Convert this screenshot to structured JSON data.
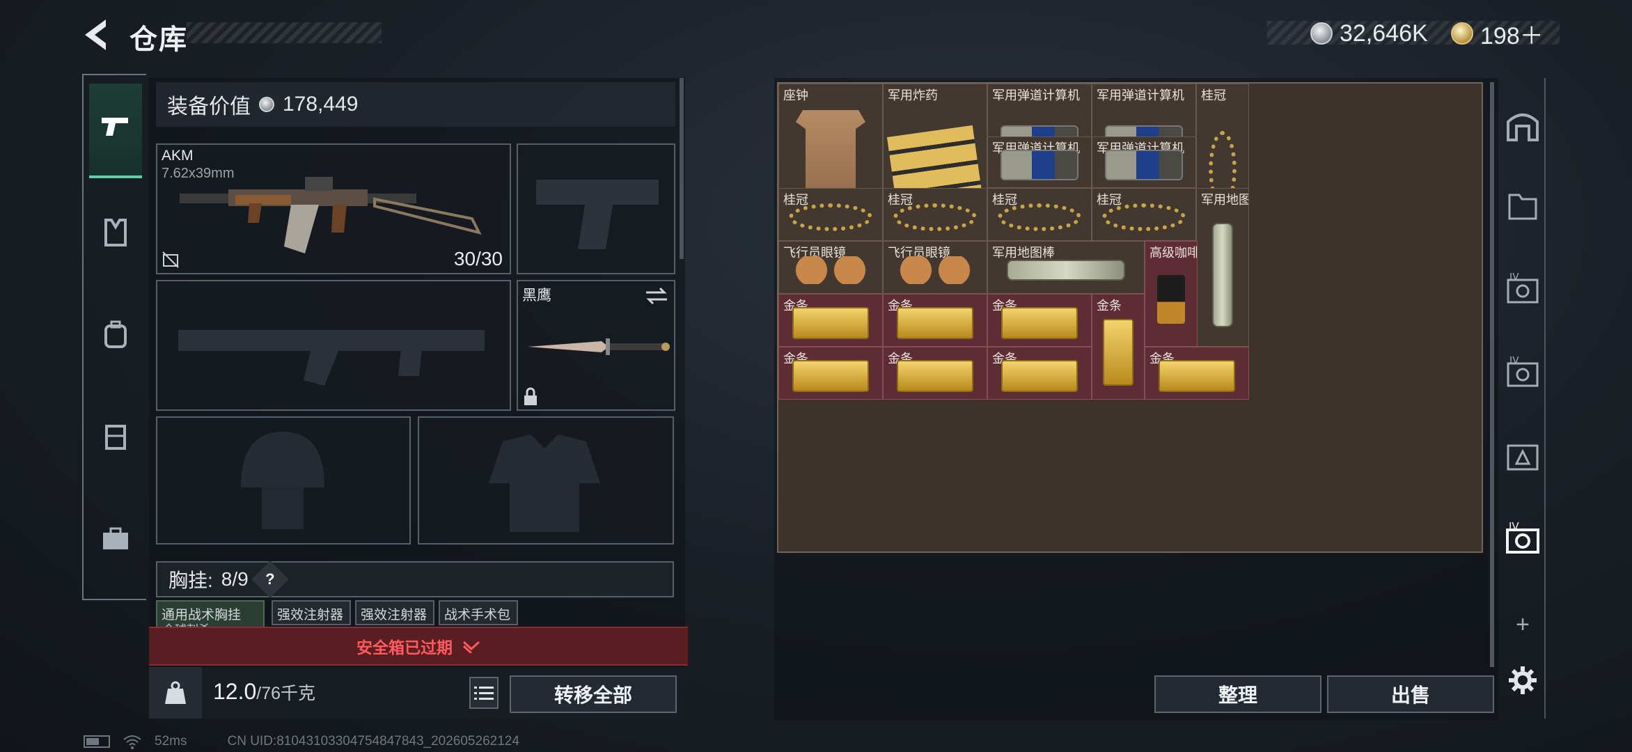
{
  "header": {
    "title": "仓库",
    "currencies": [
      {
        "icon": "silver-coin-icon",
        "value": "32,646K"
      },
      {
        "icon": "gold-coin-icon",
        "value": "198＋"
      }
    ]
  },
  "left_nav": {
    "items": [
      {
        "icon": "pistol-icon",
        "active": true
      },
      {
        "icon": "armor-vest-icon",
        "active": false
      },
      {
        "icon": "backpack-icon",
        "active": false
      },
      {
        "icon": "case-icon",
        "active": false
      },
      {
        "icon": "toolbox-icon",
        "active": false
      }
    ]
  },
  "equipment": {
    "value_label": "装备价值",
    "value": "178,449",
    "primary_weapon": {
      "name": "AKM",
      "caliber": "7.62x39mm",
      "ammo": "30/30"
    },
    "melee": {
      "name": "黑鹰"
    },
    "rig": {
      "label": "胸挂:",
      "capacity": "8/9",
      "help": "?"
    },
    "rig_items": [
      {
        "label": "通用战术胸挂",
        "sub": "全球刺杀"
      },
      {
        "label": "强效注射器"
      },
      {
        "label": "强效注射器"
      },
      {
        "label": "战术手术包"
      }
    ],
    "safe_box_status": "安全箱已过期",
    "weight": "12.0",
    "weight_cap": "/76千克",
    "transfer_all": "转移全部"
  },
  "status_bar": {
    "ping": "52ms",
    "uid": "CN UID:81043103304754847843_202605262124"
  },
  "storage": {
    "items": [
      {
        "label": "座钟",
        "kind": "clock",
        "bg": "normal"
      },
      {
        "label": "军用炸药",
        "kind": "explosive",
        "bg": "normal"
      },
      {
        "label": "军用弹道计算机",
        "kind": "computer",
        "bg": "normal"
      },
      {
        "label": "军用弹道计算机",
        "kind": "computer",
        "bg": "normal"
      },
      {
        "label": "桂冠",
        "kind": "laurel-v",
        "bg": "normal"
      },
      {
        "label": "军用弹道计算机",
        "kind": "computer",
        "bg": "normal"
      },
      {
        "label": "军用弹道计算机",
        "kind": "computer",
        "bg": "normal"
      },
      {
        "label": "桂冠",
        "kind": "laurel",
        "bg": "normal"
      },
      {
        "label": "桂冠",
        "kind": "laurel",
        "bg": "normal"
      },
      {
        "label": "桂冠",
        "kind": "laurel",
        "bg": "normal"
      },
      {
        "label": "桂冠",
        "kind": "laurel",
        "bg": "normal"
      },
      {
        "label": "军用地图棒",
        "kind": "tube-v",
        "bg": "normal"
      },
      {
        "label": "飞行员眼镜",
        "kind": "glasses",
        "bg": "normal"
      },
      {
        "label": "飞行员眼镜",
        "kind": "glasses",
        "bg": "normal"
      },
      {
        "label": "军用地图棒",
        "kind": "tube",
        "bg": "normal"
      },
      {
        "label": "高级咖啡豆",
        "kind": "coffee",
        "bg": "red"
      },
      {
        "label": "金条",
        "kind": "gold",
        "bg": "red"
      },
      {
        "label": "金条",
        "kind": "gold",
        "bg": "red"
      },
      {
        "label": "金条",
        "kind": "gold",
        "bg": "red"
      },
      {
        "label": "金条",
        "kind": "gold-v",
        "bg": "red"
      },
      {
        "label": "金条",
        "kind": "gold",
        "bg": "red"
      },
      {
        "label": "金条",
        "kind": "gold",
        "bg": "red"
      },
      {
        "label": "金条",
        "kind": "gold",
        "bg": "red"
      },
      {
        "label": "金条",
        "kind": "gold",
        "bg": "red"
      }
    ],
    "sort_label": "整理",
    "sell_label": "出售"
  },
  "right_nav": {
    "items": [
      "warehouse-icon",
      "folder-icon",
      "tab-iv-icon",
      "tab-iv-icon",
      "tab-alert-icon",
      "tab-iv-icon"
    ],
    "add": "+",
    "settings": "settings-gear-icon"
  },
  "colors": {
    "accent_green": "#5fd0a5",
    "warning_red": "#ff5a5f",
    "cell_normal": "#43382f",
    "cell_red": "#5e2c35"
  }
}
